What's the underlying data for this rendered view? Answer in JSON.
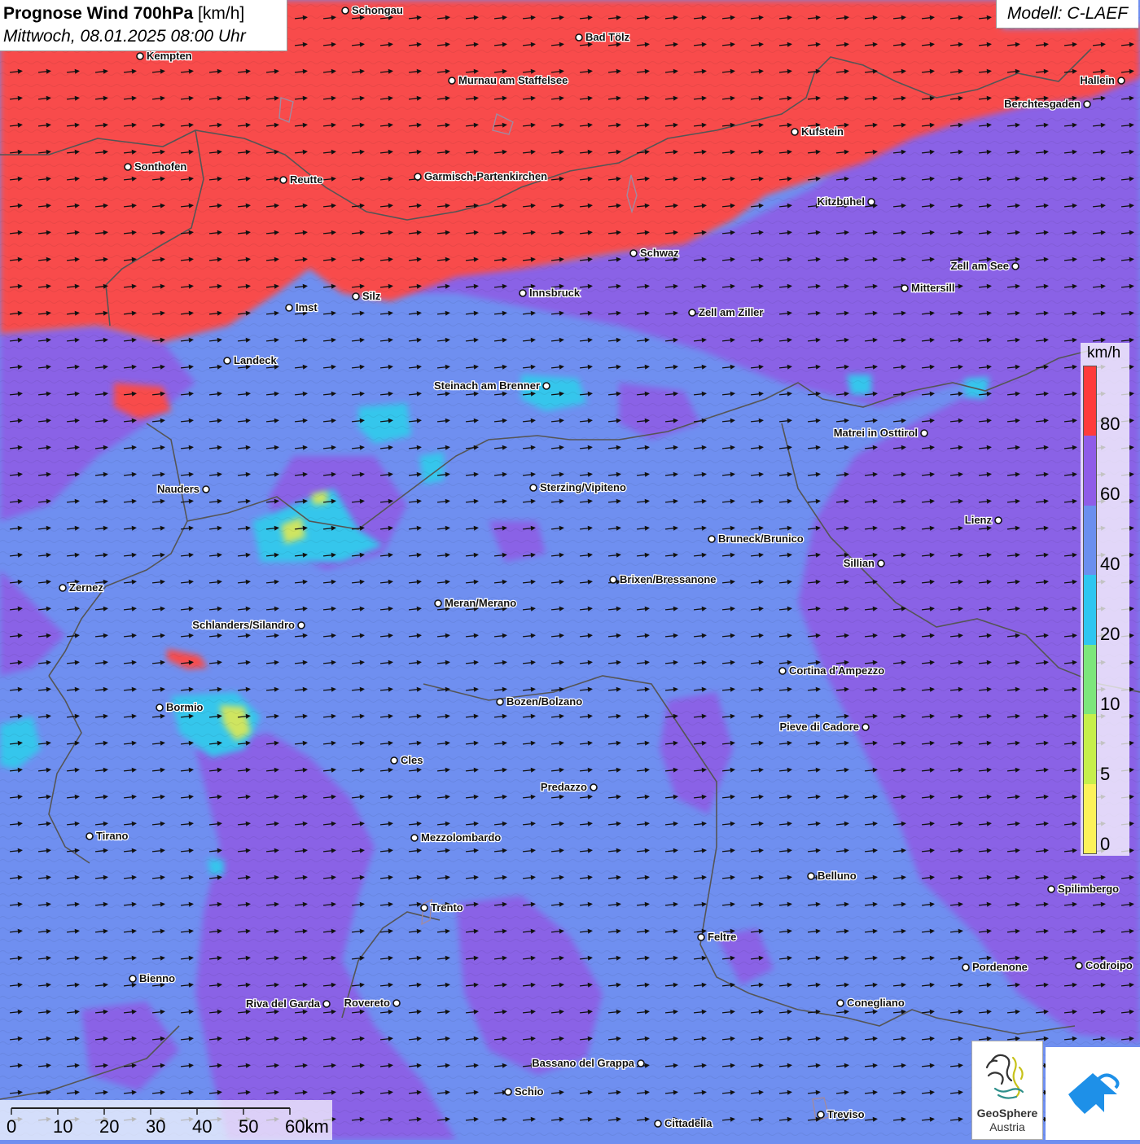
{
  "header": {
    "title_main": "Prognose Wind 700hPa",
    "title_unit": " [km/h]",
    "subtitle": "Mittwoch, 08.01.2025 08:00 Uhr",
    "model": "Modell: C-LAEF"
  },
  "legend": {
    "unit": "km/h",
    "ticks": [
      "80",
      "60",
      "40",
      "20",
      "10",
      "5",
      "0"
    ],
    "colors": [
      "#c8c8ff",
      "#ff3b3b",
      "#8f5ce8",
      "#6b8fef",
      "#2ec6f0",
      "#7de67c",
      "#c6ef4b",
      "#fcf25a"
    ]
  },
  "scale_bar": {
    "labels": [
      "0",
      "10",
      "20",
      "30",
      "40",
      "50",
      "60km"
    ]
  },
  "logo": {
    "name_line1": "GeoSphere",
    "name_line2": "Austria"
  },
  "map_colors": {
    "strong_wind": "#f84c4c",
    "wind_60_80": "#8a62e6",
    "wind_40_60": "#6f8ff0",
    "wind_20_40": "#35c6ec",
    "wind_10_20": "#8fe083",
    "wind_5_10": "#cfe560",
    "border": "#555555",
    "lake": "#a08aa0"
  },
  "wind_arrows": {
    "direction": "east",
    "icon": "wind-arrow-icon"
  },
  "cities": [
    {
      "name": "Schongau"
    },
    {
      "name": "Bad Tölz"
    },
    {
      "name": "Kempten"
    },
    {
      "name": "Murnau am Staffelsee"
    },
    {
      "name": "Hallein"
    },
    {
      "name": "Berchtesgaden"
    },
    {
      "name": "Kufstein"
    },
    {
      "name": "Sonthofen"
    },
    {
      "name": "Reutte"
    },
    {
      "name": "Garmisch-Partenkirchen"
    },
    {
      "name": "Kitzbühel"
    },
    {
      "name": "Schwaz"
    },
    {
      "name": "Zell am See"
    },
    {
      "name": "Mittersill"
    },
    {
      "name": "Innsbruck"
    },
    {
      "name": "Silz"
    },
    {
      "name": "Imst"
    },
    {
      "name": "Zell am Ziller"
    },
    {
      "name": "Landeck"
    },
    {
      "name": "Steinach am Brenner"
    },
    {
      "name": "Matrei in Osttirol"
    },
    {
      "name": "Nauders"
    },
    {
      "name": "Sterzing/Vipiteno"
    },
    {
      "name": "Lienz"
    },
    {
      "name": "Bruneck/Brunico"
    },
    {
      "name": "Sillian"
    },
    {
      "name": "Zernez"
    },
    {
      "name": "Brixen/Bressanone"
    },
    {
      "name": "Meran/Merano"
    },
    {
      "name": "Schlanders/Silandro"
    },
    {
      "name": "Cortina d'Ampezzo"
    },
    {
      "name": "Bozen/Bolzano"
    },
    {
      "name": "Bormio"
    },
    {
      "name": "Pieve di Cadore"
    },
    {
      "name": "Cles"
    },
    {
      "name": "Predazzo"
    },
    {
      "name": "Tirano"
    },
    {
      "name": "Mezzolombardo"
    },
    {
      "name": "Belluno"
    },
    {
      "name": "Spilimbergo"
    },
    {
      "name": "Trento"
    },
    {
      "name": "Feltre"
    },
    {
      "name": "Pordenone"
    },
    {
      "name": "Codroipo"
    },
    {
      "name": "Bienno"
    },
    {
      "name": "Riva del Garda"
    },
    {
      "name": "Rovereto"
    },
    {
      "name": "Conegliano"
    },
    {
      "name": "Bassano del Grappa"
    },
    {
      "name": "Schio"
    },
    {
      "name": "Treviso"
    },
    {
      "name": "Cittadella"
    }
  ]
}
